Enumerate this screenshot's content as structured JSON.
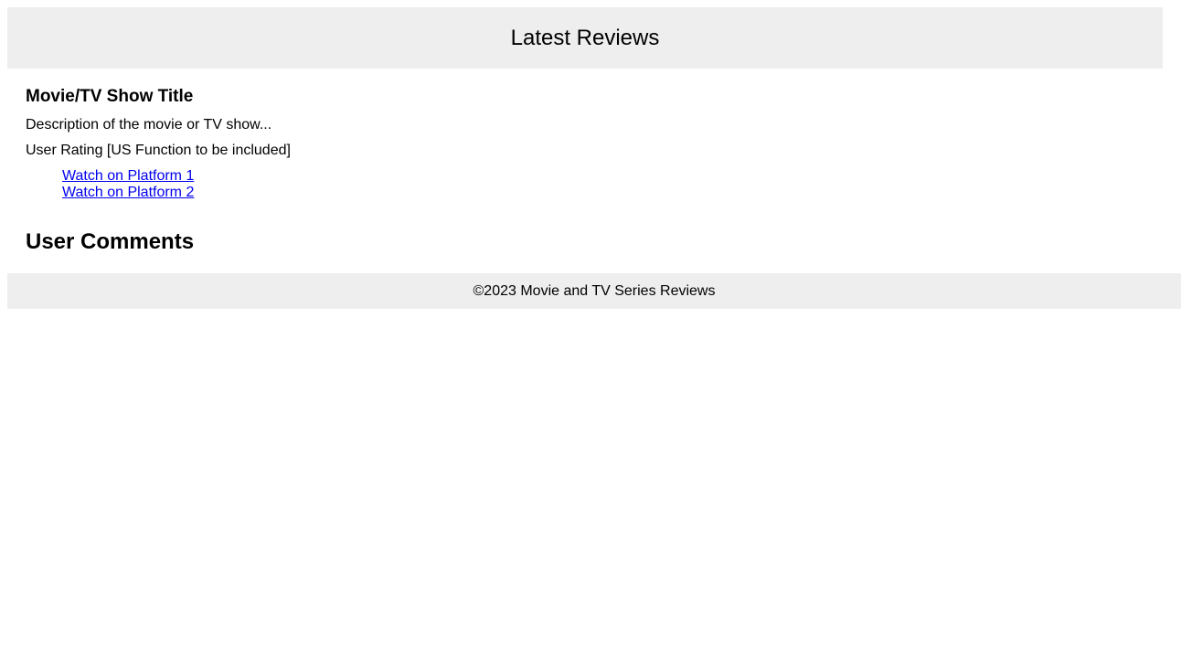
{
  "header": {
    "title": "Latest Reviews"
  },
  "review": {
    "title": "Movie/TV Show Title",
    "description": "Description of the movie or TV show...",
    "rating": "User Rating [US Function to be included]",
    "platforms": [
      {
        "label": "Watch on Platform 1"
      },
      {
        "label": "Watch on Platform 2"
      }
    ]
  },
  "comments": {
    "heading": "User Comments"
  },
  "footer": {
    "text": "©2023 Movie and TV Series Reviews"
  },
  "colors": {
    "header_bg": "#eeeeee",
    "footer_bg": "#eeeeee",
    "link": "#0000ee"
  }
}
